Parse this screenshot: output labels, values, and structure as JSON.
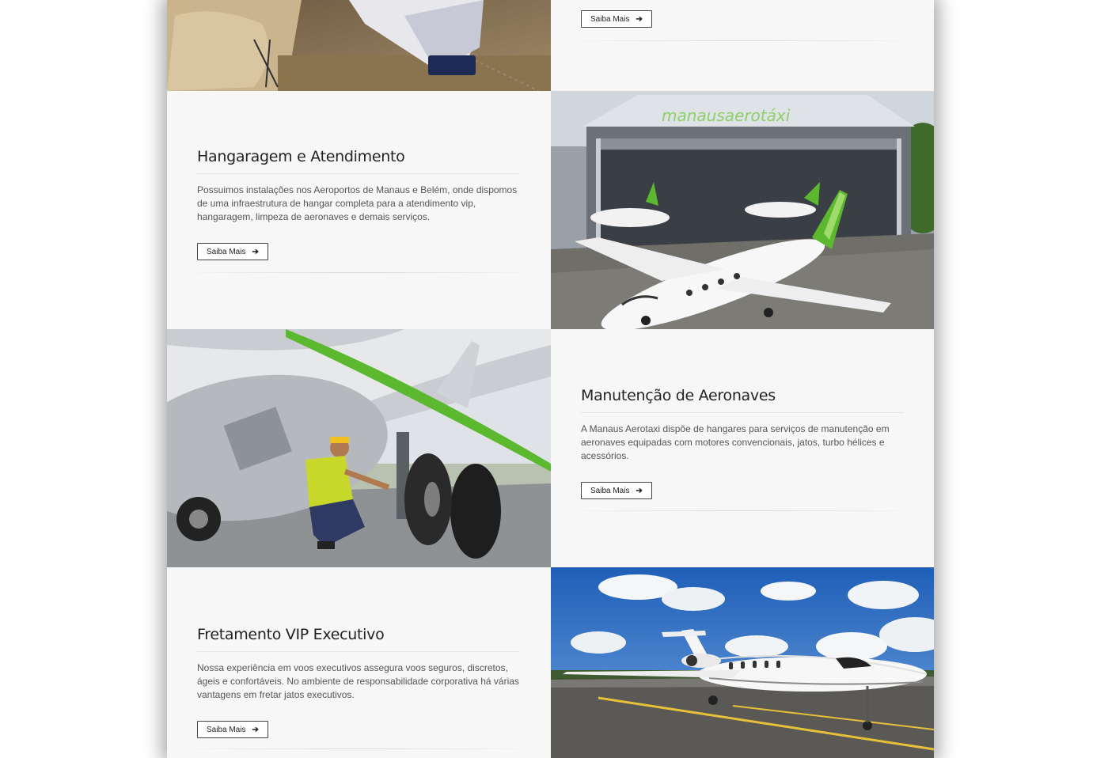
{
  "sections": [
    {
      "button_label": "Saiba Mais"
    },
    {
      "title": "Hangaragem e Atendimento",
      "description": "Possuimos instalações nos Aeroportos de Manaus e Belém, onde dispomos de uma infraestrutura de hangar completa para a atendimento vip, hangaragem, limpeza de aeronaves e demais serviços.",
      "button_label": "Saiba Mais",
      "image_sign": "manausaerotáxi"
    },
    {
      "title": "Manutenção de Aeronaves",
      "description": "A Manaus Aerotaxi dispõe de hangares para serviços de manutenção em aeronaves equipadas com motores convencionais, jatos, turbo hélices e acessórios.",
      "button_label": "Saiba Mais"
    },
    {
      "title": "Fretamento VIP Executivo",
      "description": "Nossa experiência em voos executivos assegura voos seguros, discretos, ágeis e confortáveis. No ambiente de responsabilidade corporativa há várias vantagens em fretar jatos executivos.",
      "button_label": "Saiba Mais"
    }
  ],
  "icons": {
    "button_arrow": "arrow-right-icon"
  },
  "colors": {
    "accent_green": "#5cb82e",
    "background": "#f7f7f7",
    "text": "#222222"
  }
}
